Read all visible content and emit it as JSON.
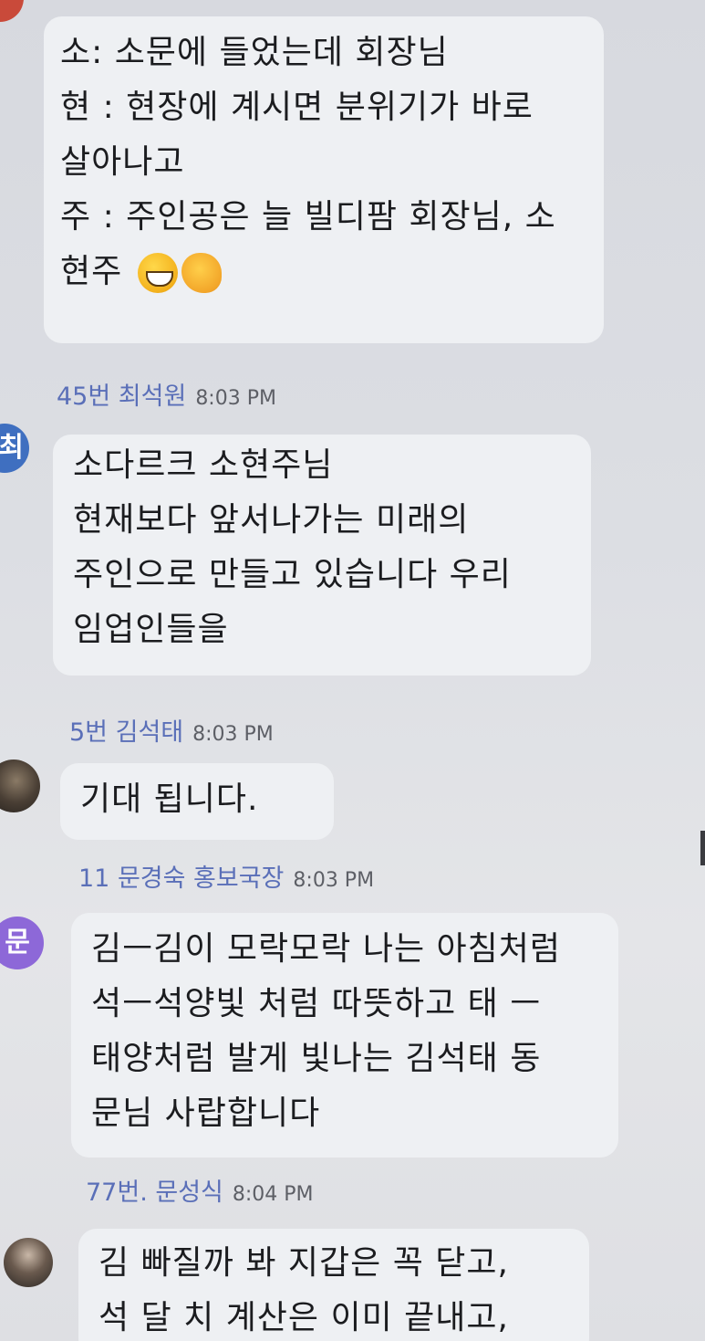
{
  "messages": [
    {
      "lines": [
        "소: 소문에 들었는데 회장님",
        "현 : 현장에 계시면 분위기가 바로",
        "살아나고",
        "주 : 주인공은 늘 빌디팜 회장님, 소",
        "현주"
      ],
      "emojis": [
        "grinning-face-emoji",
        "clapping-hands-emoji"
      ]
    },
    {
      "sender": "45번 최석원",
      "time": "8:03 PM",
      "avatar_text": "최",
      "lines": [
        "소다르크 소현주님",
        "현재보다 앞서나가는 미래의",
        "주인으로 만들고 있습니다 우리",
        "임업인들을"
      ]
    },
    {
      "sender": "5번 김석태",
      "time": "8:03 PM",
      "lines": [
        "기대 됩니다."
      ]
    },
    {
      "sender": "11 문경숙 홍보국장",
      "time": "8:03 PM",
      "avatar_text": "문",
      "lines": [
        "김ㅡ김이 모락모락 나는 아침처럼",
        "석ㅡ석양빛 처럼  따뜻하고  태 ㅡ",
        "태양처럼  발게 빛나는 김석태 동",
        "문님 사랍합니다"
      ]
    },
    {
      "sender": "77번. 문성식",
      "time": "8:04 PM",
      "lines": [
        "김 빠질까 봐 지갑은 꼭 닫고,",
        "석 달 치 계산은 이미 끝내고,"
      ]
    }
  ],
  "colors": {
    "bubble": "#eef0f3",
    "sender_name": "#5a6fb8",
    "avatar_blue": "#3f6fc0",
    "avatar_purple": "#8d68d8"
  }
}
